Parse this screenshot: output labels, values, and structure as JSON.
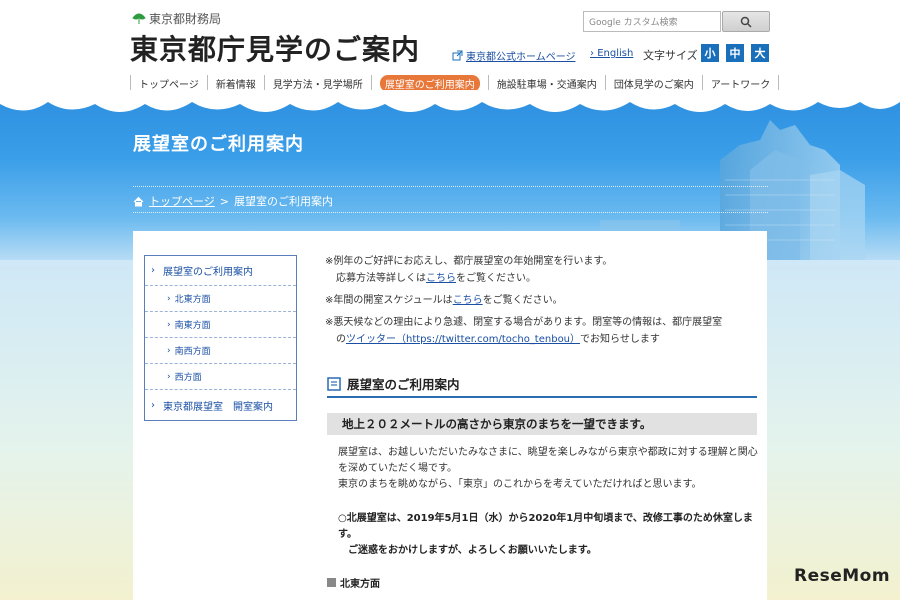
{
  "header": {
    "bureau": "東京都財務局",
    "site_title": "東京都庁見学のご案内",
    "search_placeholder": "Google カスタム検索",
    "official_link": "東京都公式ホームページ",
    "english_link": "English",
    "font_size_label": "文字サイズ",
    "font_sizes": [
      "小",
      "中",
      "大"
    ],
    "nav": [
      "トップページ",
      "新着情報",
      "見学方法・見学場所",
      "展望室のご利用案内",
      "施設駐車場・交通案内",
      "団体見学のご案内",
      "アートワーク"
    ]
  },
  "hero": {
    "title": "展望室のご利用案内",
    "breadcrumb_home": "トップページ",
    "breadcrumb_sep": ">",
    "breadcrumb_current": "展望室のご利用案内"
  },
  "sidenav": {
    "items": [
      {
        "label": "展望室のご利用案内",
        "level": "top"
      },
      {
        "label": "北東方面",
        "level": "sub"
      },
      {
        "label": "南東方面",
        "level": "sub"
      },
      {
        "label": "南西方面",
        "level": "sub"
      },
      {
        "label": "西方面",
        "level": "sub"
      },
      {
        "label": "東京都展望室　開室案内",
        "level": "top"
      }
    ]
  },
  "notes": {
    "n1_text": "※例年のご好評にお応えし、都庁展望室の年始開室を行います。",
    "n1_sub_pre": "応募方法等詳しくは",
    "n1_link": "こちら",
    "n1_sub_post": "をご覧ください。",
    "n2_pre": "※年間の開室スケジュールは",
    "n2_link": "こちら",
    "n2_post": "をご覧ください。",
    "n3_text": "※悪天候などの理由により急遽、閉室する場合があります。閉室等の情報は、都庁展望室",
    "n3_sub_pre": "の",
    "n3_link": "ツイッター（https://twitter.com/tocho_tenbou）",
    "n3_sub_post": "でお知らせします"
  },
  "section": {
    "heading": "展望室のご利用案内",
    "lead": "地上２０２メートルの高さから東京のまちを一望できます。",
    "body_1": "展望室は、お越しいただいたみなさまに、眺望を楽しみながら東京や都政に対する理解と関心を深めていただく場です。",
    "body_2": "東京のまちを眺めながら、「東京」のこれからを考えていただければと思います。",
    "notice_1": "○北展望室は、2019年5月1日（水）から2020年1月中旬頃まで、改修工事のため休室します。",
    "notice_2": "ご迷惑をおかけしますが、よろしくお願いいたします。",
    "sub_heading": "北東方面"
  },
  "watermark": "ReseMom",
  "colors": {
    "accent_blue": "#1a6fba",
    "nav_active": "#e8773a",
    "link": "#1a4fa3"
  }
}
